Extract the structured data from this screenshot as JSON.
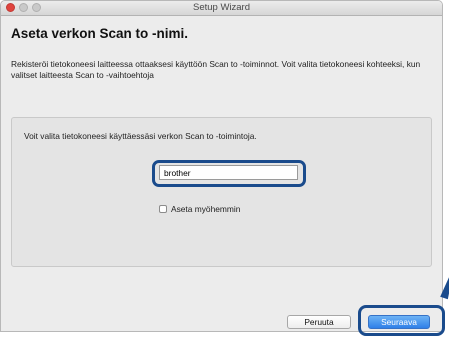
{
  "window": {
    "title": "Setup Wizard"
  },
  "page": {
    "heading": "Aseta verkon Scan to -nimi.",
    "description": "Rekisteröi tietokoneesi laitteessa ottaaksesi käyttöön Scan to -toiminnot. Voit valita tietokoneesi kohteeksi, kun valitset laitteesta Scan to -vaihtoehtoja"
  },
  "panel": {
    "instruction": "Voit valita tietokoneesi käyttäessäsi verkon Scan to -toimintoja.",
    "name_field": {
      "value": "brother"
    },
    "later_checkbox": {
      "label": "Aseta myöhemmin",
      "checked": false
    }
  },
  "buttons": {
    "cancel_label": "Peruuta",
    "next_label": "Seuraava"
  },
  "colors": {
    "highlight": "#1a4b8c",
    "default_button": "#2f80e8",
    "close_button": "#e0443e"
  }
}
